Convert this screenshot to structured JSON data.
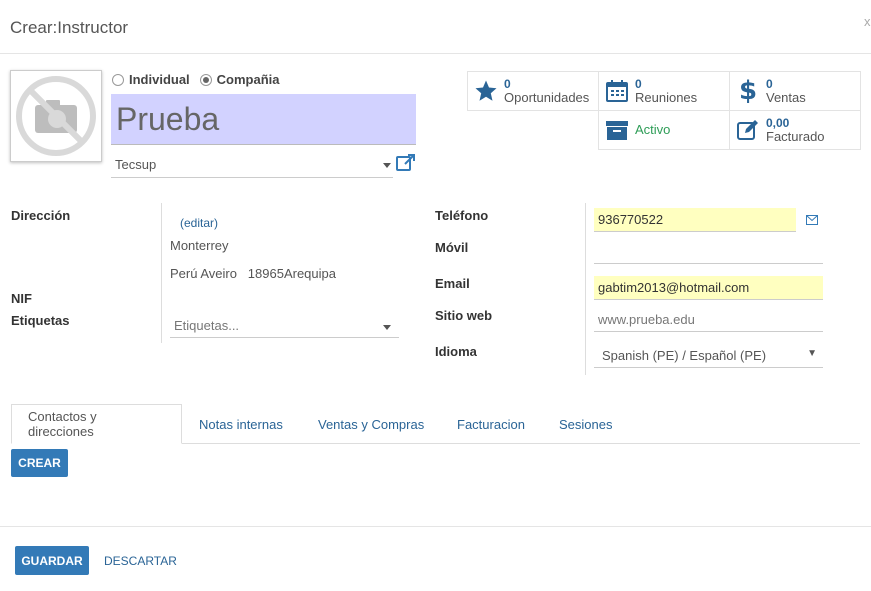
{
  "dialog": {
    "title": "Crear:Instructor",
    "close": "x"
  },
  "partner_type": {
    "individual": "Individual",
    "company": "Compañia",
    "selected": "company"
  },
  "name": "Prueba",
  "parent_company": "Tecsup",
  "stats": [
    {
      "num": "0",
      "label": "Oportunidades",
      "icon": "star-icon"
    },
    {
      "num": "0",
      "label": "Reuniones",
      "icon": "calendar-icon"
    },
    {
      "num": "0",
      "label": "Ventas",
      "icon": "dollar-icon"
    },
    {
      "label": "Activo",
      "icon": "archive-icon"
    },
    {
      "num": "0,00",
      "label": "Facturado",
      "icon": "edit-icon"
    }
  ],
  "left_form": {
    "address_label": "Dirección",
    "edit_link": "(editar)",
    "city": "Monterrey",
    "address_line": "Perú Aveiro   18965Arequipa",
    "nif_label": "NIF",
    "tags_label": "Etiquetas",
    "tags_placeholder": "Etiquetas..."
  },
  "right_form": {
    "phone_label": "Teléfono",
    "phone": "936770522",
    "mobile_label": "Móvil",
    "mobile": "",
    "email_label": "Email",
    "email": "gabtim2013@hotmail.com",
    "website_label": "Sitio web",
    "website_placeholder": "www.prueba.edu",
    "language_label": "Idioma",
    "language": "Spanish (PE) / Español (PE)"
  },
  "tabs": [
    "Contactos y direcciones",
    "Notas internas",
    "Ventas y Compras",
    "Facturacion",
    "Sesiones"
  ],
  "active_tab": 0,
  "create_button": "CREAR",
  "footer": {
    "save": "GUARDAR",
    "discard": "DESCARTAR"
  },
  "colors": {
    "accent": "#337ab7",
    "name_bg": "#d2d2ff",
    "required_bg": "#ffffc0",
    "active_green": "#2e9d57",
    "icon_blue": "#2a6496"
  }
}
